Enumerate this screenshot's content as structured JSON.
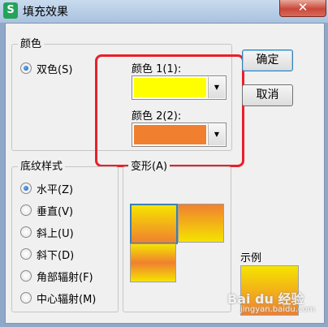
{
  "window": {
    "title": "填充效果",
    "app_icon": "S",
    "close": "✕"
  },
  "colors_group": {
    "legend": "颜色",
    "option": "双色(S)",
    "color1_label": "颜色 1(1):",
    "color1_value": "#ffff00",
    "color2_label": "颜色 2(2):",
    "color2_value": "#f08030"
  },
  "shading_group": {
    "legend": "底纹样式",
    "options": [
      "水平(Z)",
      "垂直(V)",
      "斜上(U)",
      "斜下(D)",
      "角部辐射(F)",
      "中心辐射(M)"
    ],
    "selected": "水平(Z)"
  },
  "variants": {
    "legend": "变形(A)"
  },
  "sample": {
    "label": "示例"
  },
  "buttons": {
    "ok": "确定",
    "cancel": "取消"
  },
  "watermark": {
    "text": "Bai du 经验",
    "url": "jingyan.baidu.com"
  },
  "accent": {
    "annotation": "#e8202a",
    "selection": "#3c7fb1"
  }
}
